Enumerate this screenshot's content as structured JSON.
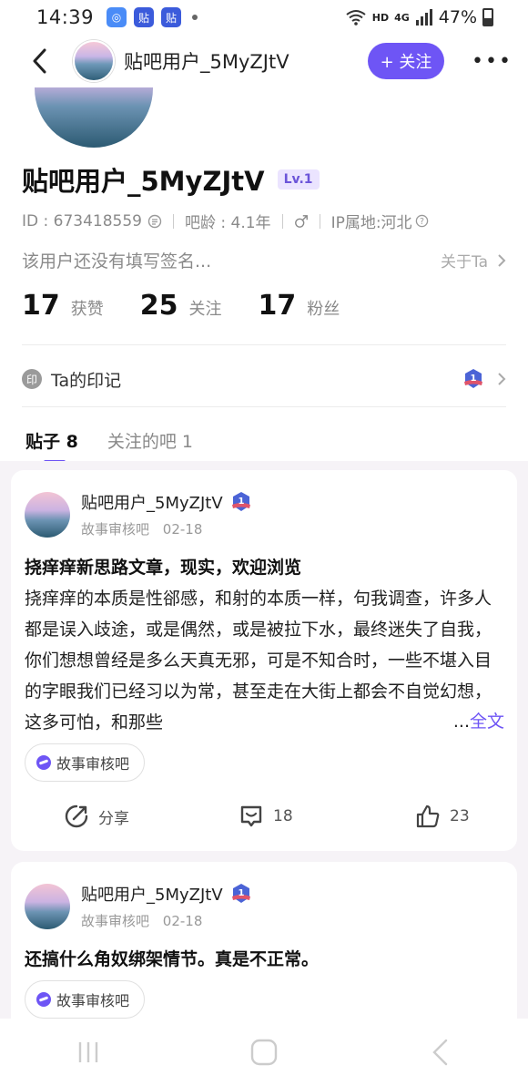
{
  "status_bar": {
    "time": "14:39",
    "net": "HD",
    "signal": "4G",
    "battery": "47%"
  },
  "nav": {
    "name": "贴吧用户_5MyZJtV",
    "follow_label": "+ 关注",
    "more_label": "•••"
  },
  "profile": {
    "name": "贴吧用户_5MyZJtV",
    "level": "Lv.1",
    "id_text": "ID : 673418559",
    "age_text": "吧龄 : 4.1年",
    "ip_text": "IP属地:河北",
    "signature": "该用户还没有填写签名...",
    "about_label": "关于Ta",
    "stats": [
      {
        "num": "17",
        "label": "获赞"
      },
      {
        "num": "25",
        "label": "关注"
      },
      {
        "num": "17",
        "label": "粉丝"
      }
    ],
    "mark_icon": "印",
    "mark_label": "Ta的印记"
  },
  "tabs": [
    {
      "label": "贴子 8"
    },
    {
      "label": "关注的吧 1"
    }
  ],
  "posts": [
    {
      "user": "贴吧用户_5MyZJtV",
      "forum": "故事审核吧",
      "date": "02-18",
      "title": "挠痒痒新思路文章，现实，欢迎浏览",
      "body": "挠痒痒的本质是性郤感，和射的本质一样，句我调查，许多人都是误入歧途，或是偶然，或是被拉下水，最终迷失了自我，你们想想曾经是多么天真无邪，可是不知合时，一些不堪入目的字眼我们已经习以为常，甚至走在大街上都会不自觉幻想，这多可怕，和那些",
      "ellipsis": "...",
      "more_label": "全文",
      "chip": "故事审核吧",
      "share_label": "分享",
      "comments": "18",
      "likes": "23"
    },
    {
      "user": "贴吧用户_5MyZJtV",
      "forum": "故事审核吧",
      "date": "02-18",
      "title": "还搞什么角奴绑架情节。真是不正常。",
      "chip": "故事审核吧"
    }
  ],
  "colors": {
    "accent": "#6e55f5",
    "feed_bg": "#f6f3f7"
  }
}
